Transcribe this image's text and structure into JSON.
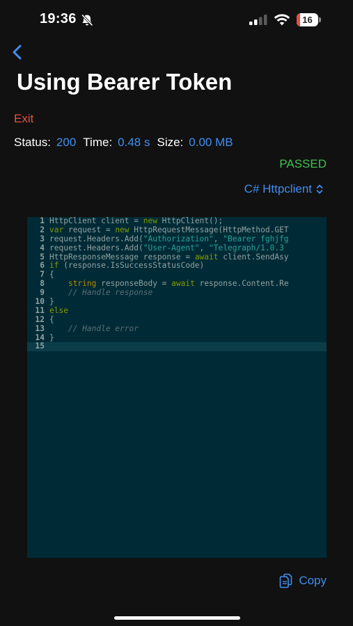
{
  "status_bar": {
    "time": "19:36",
    "battery_level": "16",
    "battery_fraction": 0.16
  },
  "nav": {
    "title": "Using Bearer Token",
    "exit_label": "Exit"
  },
  "stats": {
    "status_label": "Status:",
    "status_value": "200",
    "time_label": "Time:",
    "time_value": "0.48 s",
    "size_label": "Size:",
    "size_value": "0.00 MB"
  },
  "result": "PASSED",
  "language": "C# Httpclient",
  "code": {
    "active_line": 15,
    "lines": [
      {
        "n": "1",
        "parts": [
          {
            "t": "HttpClient client = "
          },
          {
            "t": "new",
            "c": "kw"
          },
          {
            "t": " HttpClient();"
          }
        ]
      },
      {
        "n": "2",
        "parts": [
          {
            "t": "var",
            "c": "kw"
          },
          {
            "t": " request = "
          },
          {
            "t": "new",
            "c": "kw"
          },
          {
            "t": " HttpRequestMessage(HttpMethod.GET"
          }
        ]
      },
      {
        "n": "3",
        "parts": [
          {
            "t": "request.Headers.Add("
          },
          {
            "t": "\"Authorization\"",
            "c": "str"
          },
          {
            "t": ", "
          },
          {
            "t": "\"Bearer fghjfg",
            "c": "str"
          }
        ]
      },
      {
        "n": "4",
        "parts": [
          {
            "t": "request.Headers.Add("
          },
          {
            "t": "\"User-Agent\"",
            "c": "str"
          },
          {
            "t": ", "
          },
          {
            "t": "\"Telegraph/1.0.3",
            "c": "str"
          }
        ]
      },
      {
        "n": "5",
        "parts": [
          {
            "t": "HttpResponseMessage response = "
          },
          {
            "t": "await",
            "c": "kw"
          },
          {
            "t": " client.SendAsy"
          }
        ]
      },
      {
        "n": "6",
        "parts": [
          {
            "t": "if",
            "c": "kw"
          },
          {
            "t": " (response.IsSuccessStatusCode)"
          }
        ]
      },
      {
        "n": "7",
        "parts": [
          {
            "t": "{"
          }
        ]
      },
      {
        "n": "8",
        "parts": [
          {
            "t": "    "
          },
          {
            "t": "string",
            "c": "tp"
          },
          {
            "t": " responseBody = "
          },
          {
            "t": "await",
            "c": "kw"
          },
          {
            "t": " response.Content.Re"
          }
        ]
      },
      {
        "n": "9",
        "parts": [
          {
            "t": "    "
          },
          {
            "t": "// Handle response",
            "c": "cm"
          }
        ]
      },
      {
        "n": "10",
        "parts": [
          {
            "t": "}"
          }
        ]
      },
      {
        "n": "11",
        "parts": [
          {
            "t": "else",
            "c": "kw"
          }
        ]
      },
      {
        "n": "12",
        "parts": [
          {
            "t": "{"
          }
        ]
      },
      {
        "n": "13",
        "parts": [
          {
            "t": "    "
          },
          {
            "t": "// Handle error",
            "c": "cm"
          }
        ]
      },
      {
        "n": "14",
        "parts": [
          {
            "t": "}"
          }
        ]
      },
      {
        "n": "15",
        "parts": []
      }
    ]
  },
  "copy_label": "Copy",
  "icons": {
    "back": "chevron-left-icon",
    "bell": "bell-slash-icon",
    "signal": "cellular-signal-icon",
    "wifi": "wifi-icon",
    "select": "chevron-up-down-icon",
    "copy": "copy-icon"
  },
  "colors": {
    "background": "#111111",
    "accent": "#3f8ff0",
    "danger": "#e5533f",
    "success": "#3fc14e",
    "editor_bg": "#002b36"
  }
}
